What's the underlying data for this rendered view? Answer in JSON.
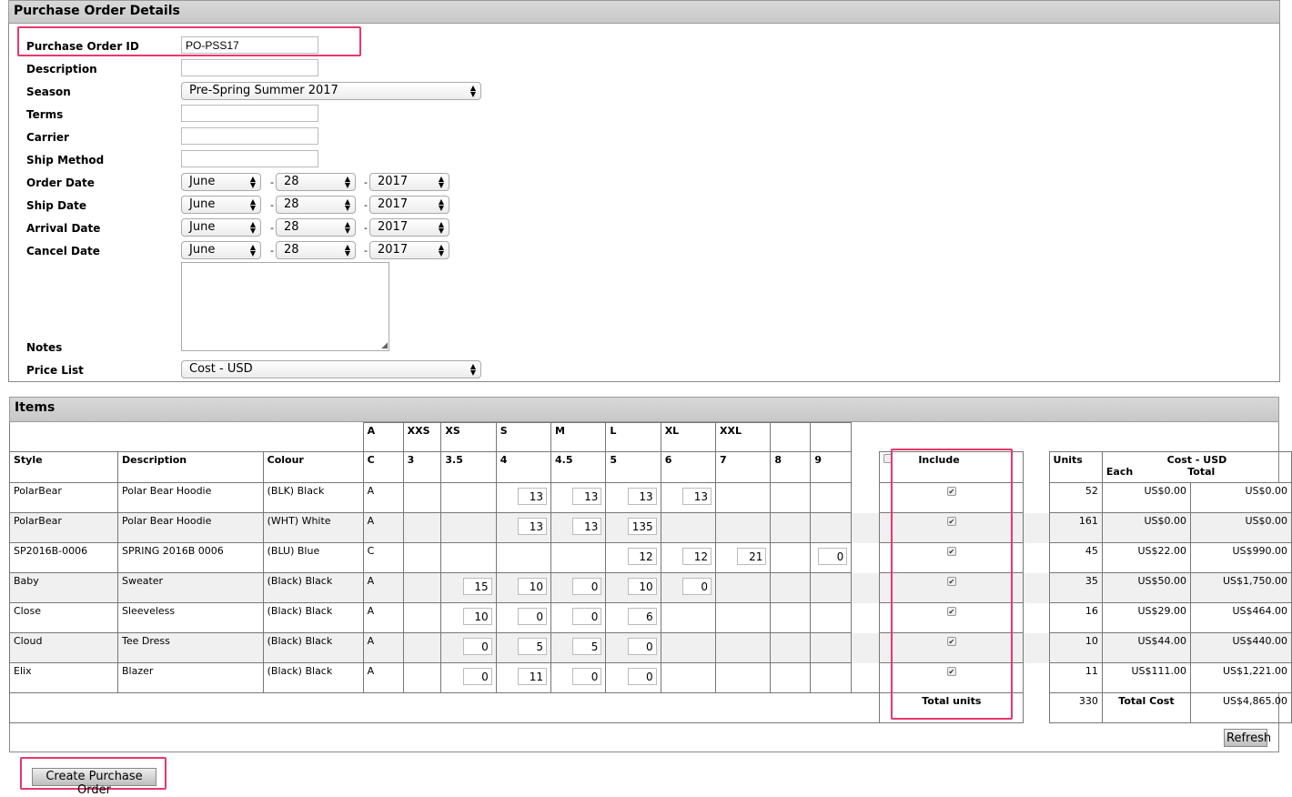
{
  "po": {
    "title": "Purchase Order Details",
    "fields": {
      "po_id_label": "Purchase Order ID",
      "po_id_value": "PO-PSS17",
      "description_label": "Description",
      "description_value": "",
      "season_label": "Season",
      "season_value": "Pre-Spring Summer 2017",
      "terms_label": "Terms",
      "carrier_label": "Carrier",
      "ship_method_label": "Ship Method",
      "order_date_label": "Order Date",
      "ship_date_label": "Ship Date",
      "arrival_date_label": "Arrival Date",
      "cancel_date_label": "Cancel Date",
      "notes_label": "Notes",
      "price_list_label": "Price List",
      "price_list_value": "Cost - USD"
    },
    "dates": {
      "order": {
        "month": "June",
        "day": "28",
        "year": "2017"
      },
      "ship": {
        "month": "June",
        "day": "28",
        "year": "2017"
      },
      "arrival": {
        "month": "June",
        "day": "28",
        "year": "2017"
      },
      "cancel": {
        "month": "June",
        "day": "28",
        "year": "2017"
      }
    }
  },
  "items": {
    "title": "Items",
    "size_top": [
      "A",
      "XXS",
      "XS",
      "S",
      "M",
      "L",
      "XL",
      "XXL",
      "",
      ""
    ],
    "size_bottom": [
      "C",
      "3",
      "3.5",
      "4",
      "4.5",
      "5",
      "6",
      "7",
      "8",
      "9"
    ],
    "headers": {
      "style": "Style",
      "description": "Description",
      "colour": "Colour",
      "include": "Include",
      "units": "Units",
      "cost": "Cost - USD",
      "each": "Each",
      "total": "Total"
    },
    "rows": [
      {
        "style": "PolarBear",
        "description": "Polar Bear Hoodie",
        "colour": "(BLK) Black",
        "ac": "A",
        "q": [
          "",
          "",
          "13",
          "13",
          "13",
          "13",
          "",
          "",
          ""
        ],
        "units": "52",
        "each": "US$0.00",
        "total": "US$0.00"
      },
      {
        "style": "PolarBear",
        "description": "Polar Bear Hoodie",
        "colour": "(WHT) White",
        "ac": "A",
        "q": [
          "",
          "",
          "13",
          "13",
          "135",
          "",
          "",
          "",
          ""
        ],
        "units": "161",
        "each": "US$0.00",
        "total": "US$0.00"
      },
      {
        "style": "SP2016B-0006",
        "description": "SPRING 2016B 0006",
        "colour": "(BLU) Blue",
        "ac": "C",
        "q": [
          "",
          "",
          "",
          "",
          "12",
          "12",
          "21",
          "",
          "0"
        ],
        "units": "45",
        "each": "US$22.00",
        "total": "US$990.00"
      },
      {
        "style": "Baby",
        "description": "Sweater",
        "colour": "(Black) Black",
        "ac": "A",
        "q": [
          "",
          "15",
          "10",
          "0",
          "10",
          "0",
          "",
          "",
          ""
        ],
        "units": "35",
        "each": "US$50.00",
        "total": "US$1,750.00"
      },
      {
        "style": "Close",
        "description": "Sleeveless",
        "colour": "(Black) Black",
        "ac": "A",
        "q": [
          "",
          "10",
          "0",
          "0",
          "6",
          "",
          "",
          "",
          ""
        ],
        "units": "16",
        "each": "US$29.00",
        "total": "US$464.00"
      },
      {
        "style": "Cloud",
        "description": "Tee Dress",
        "colour": "(Black) Black",
        "ac": "A",
        "q": [
          "",
          "0",
          "5",
          "5",
          "0",
          "",
          "",
          "",
          ""
        ],
        "units": "10",
        "each": "US$44.00",
        "total": "US$440.00"
      },
      {
        "style": "Elix",
        "description": "Blazer",
        "colour": "(Black) Black",
        "ac": "A",
        "q": [
          "",
          "0",
          "11",
          "0",
          "0",
          "",
          "",
          "",
          ""
        ],
        "units": "11",
        "each": "US$111.00",
        "total": "US$1,221.00"
      }
    ],
    "footer": {
      "total_units_label": "Total units",
      "total_units": "330",
      "total_cost_label": "Total Cost",
      "total_cost": "US$4,865.00"
    },
    "refresh_label": "Refresh"
  },
  "create_label": "Create Purchase Order"
}
